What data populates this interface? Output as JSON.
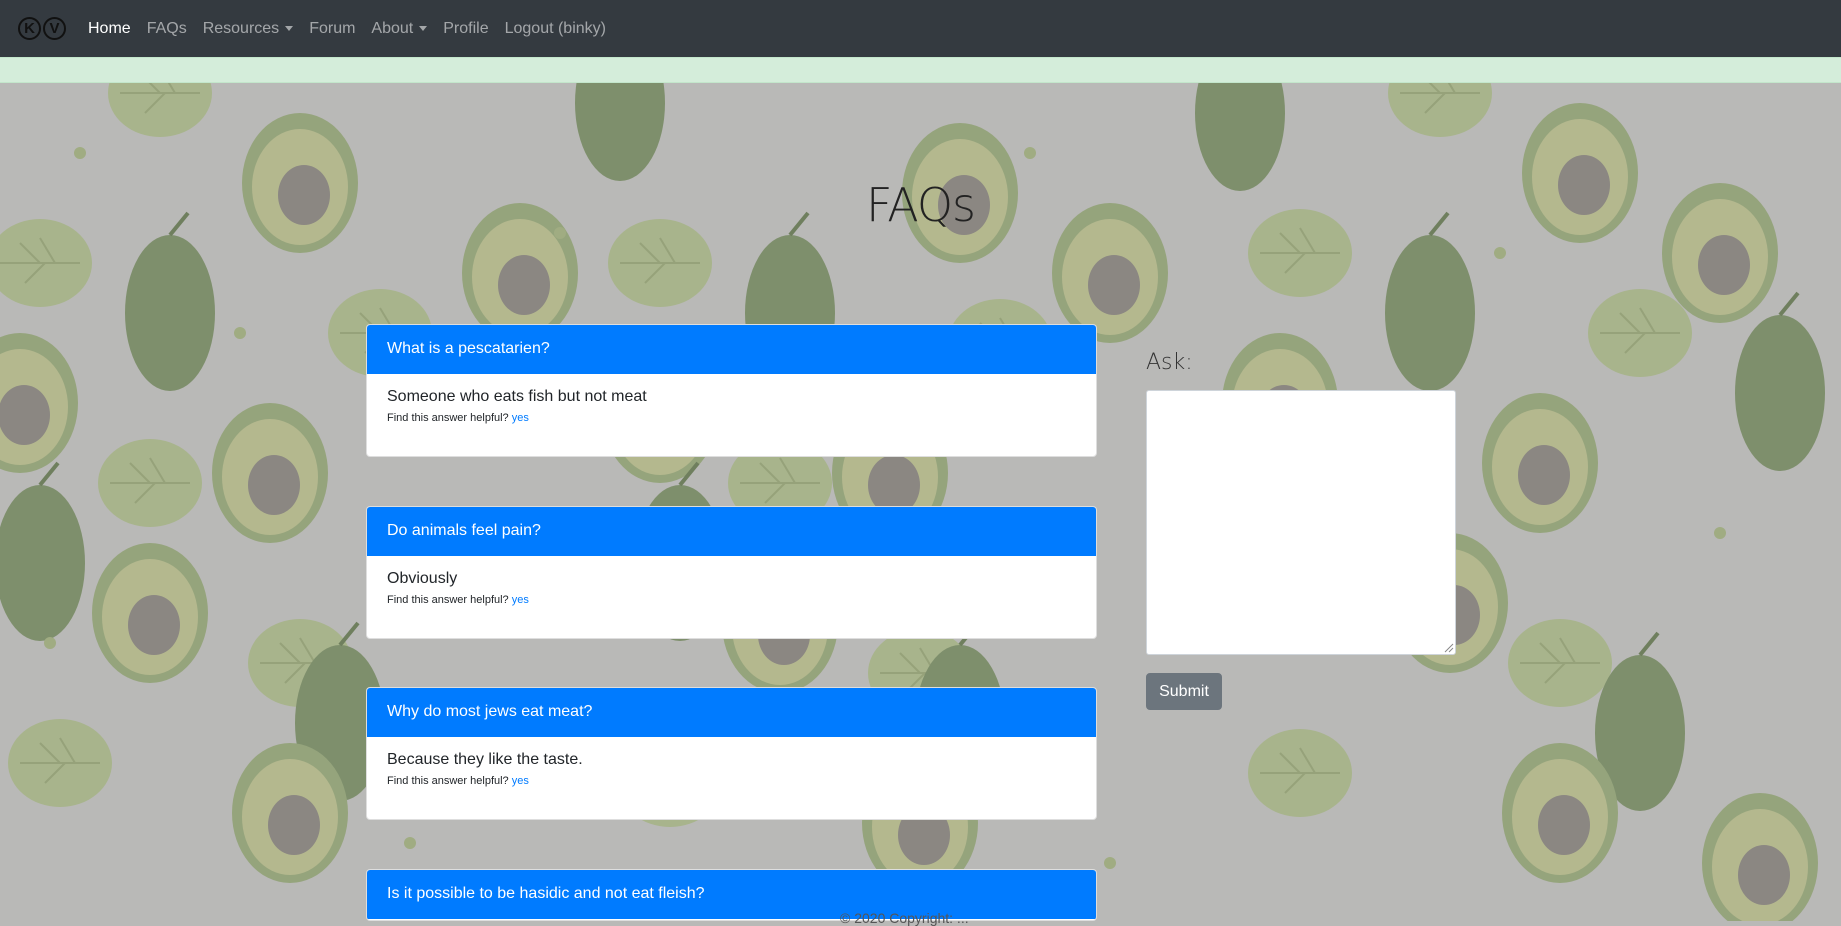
{
  "navbar": {
    "brand": {
      "letter_left": "K",
      "letter_right": "V",
      "subtitle": ""
    },
    "links": [
      {
        "label": "Home",
        "active": true,
        "dropdown": false
      },
      {
        "label": "FAQs",
        "active": false,
        "dropdown": false
      },
      {
        "label": "Resources",
        "active": false,
        "dropdown": true
      },
      {
        "label": "Forum",
        "active": false,
        "dropdown": false
      },
      {
        "label": "About",
        "active": false,
        "dropdown": true
      },
      {
        "label": "Profile",
        "active": false,
        "dropdown": false
      },
      {
        "label": "Logout (binky)",
        "active": false,
        "dropdown": false
      }
    ]
  },
  "page": {
    "title": "FAQs"
  },
  "faqs": [
    {
      "question": "What is a pescatarien?",
      "answer": "Someone who eats fish but not meat",
      "helpful_prompt": "Find this answer helpful?",
      "helpful_link": "yes"
    },
    {
      "question": "Do animals feel pain?",
      "answer": "Obviously",
      "helpful_prompt": "Find this answer helpful?",
      "helpful_link": "yes"
    },
    {
      "question": "Why do most jews eat meat?",
      "answer": "Because they like the taste.",
      "helpful_prompt": "Find this answer helpful?",
      "helpful_link": "yes"
    },
    {
      "question": "Is it possible to be hasidic and not eat fleish?",
      "answer": "",
      "helpful_prompt": "",
      "helpful_link": ""
    }
  ],
  "ask": {
    "label": "Ask:",
    "textarea_value": "",
    "submit_label": "Submit"
  },
  "footer": {
    "text": "© 2020 Copyright: ..."
  },
  "colors": {
    "navbar_bg": "#343a40",
    "alert_bg": "#d4edda",
    "card_header": "#007bff",
    "submit_bg": "#6c757d",
    "page_bg": "#b9b9b7"
  }
}
